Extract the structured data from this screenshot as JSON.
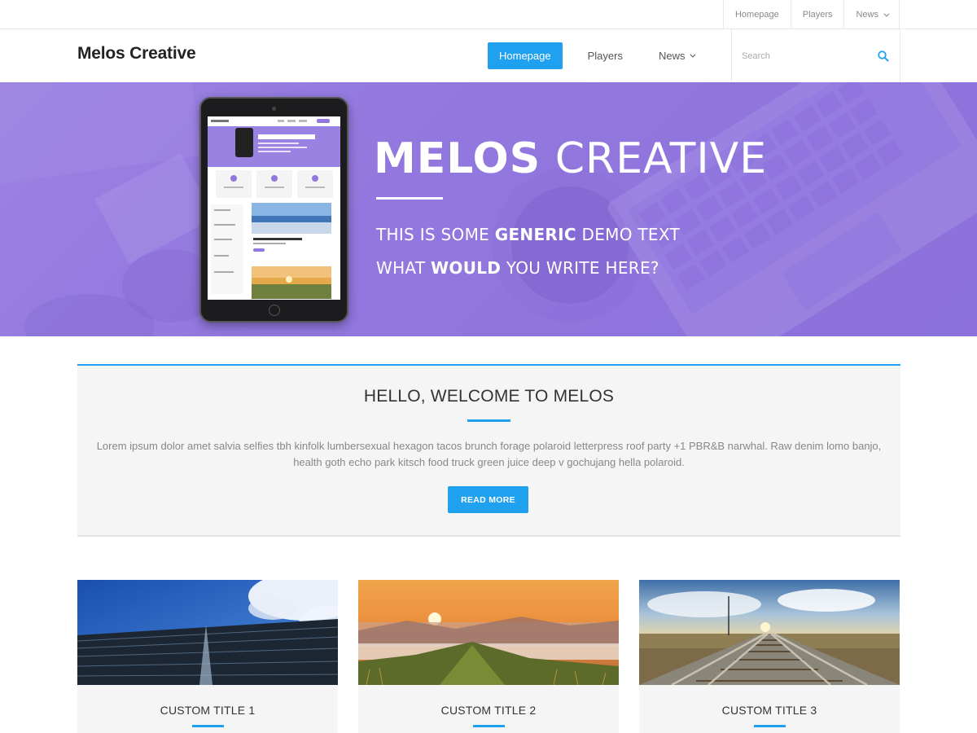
{
  "topbar": {
    "items": [
      {
        "label": "Homepage"
      },
      {
        "label": "Players"
      },
      {
        "label": "News"
      }
    ]
  },
  "header": {
    "site_title": "Melos Creative",
    "nav": [
      {
        "label": "Homepage",
        "active": true
      },
      {
        "label": "Players",
        "active": false
      },
      {
        "label": "News",
        "active": false
      }
    ],
    "search": {
      "placeholder": "Search",
      "value": ""
    }
  },
  "hero": {
    "title_bold": "MELOS",
    "title_light": " CREATIVE",
    "line1_pre": "THIS IS SOME ",
    "line1_bold": "GENERIC",
    "line1_post": " DEMO TEXT",
    "line2_pre": "WHAT ",
    "line2_bold": "WOULD",
    "line2_post": " YOU WRITE HERE?",
    "overlay_color": "#9278de"
  },
  "welcome": {
    "title": "HELLO, WELCOME TO MELOS",
    "text": "Lorem ipsum dolor amet salvia selfies tbh kinfolk lumbersexual hexagon tacos brunch forage polaroid letterpress roof party +1 PBR&B narwhal. Raw denim lomo banjo, health goth echo park kitsch food truck green juice deep v gochujang hella polaroid.",
    "button_label": "READ MORE"
  },
  "cards": [
    {
      "title": "CUSTOM TITLE 1",
      "image": "building-sky-image"
    },
    {
      "title": "CUSTOM TITLE 2",
      "image": "sunrise-hills-image"
    },
    {
      "title": "CUSTOM TITLE 3",
      "image": "railway-tracks-image"
    }
  ],
  "colors": {
    "accent": "#1fa1ef",
    "hero_purple": "#9278de",
    "panel_bg": "#f5f5f5"
  }
}
